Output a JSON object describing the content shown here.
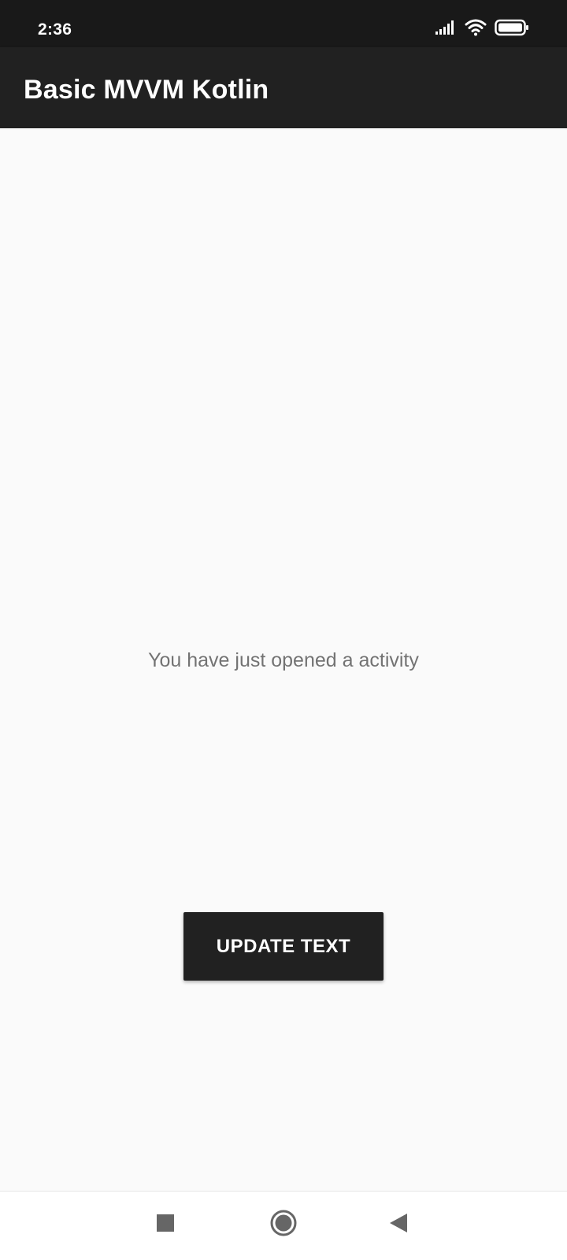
{
  "status_bar": {
    "time": "2:36",
    "icons": [
      "signal-icon",
      "wifi-icon",
      "battery-icon"
    ]
  },
  "app_bar": {
    "title": "Basic MVVM Kotlin"
  },
  "main": {
    "message": "You have just opened a activity",
    "button_label": "UPDATE TEXT"
  },
  "nav_bar": {
    "buttons": [
      "recents-icon",
      "home-icon",
      "back-icon"
    ]
  },
  "colors": {
    "status_bar": "#191919",
    "app_bar": "#212121",
    "background": "#fafafa",
    "button": "#212121",
    "message_text": "#737373",
    "nav_icon": "#666666"
  }
}
